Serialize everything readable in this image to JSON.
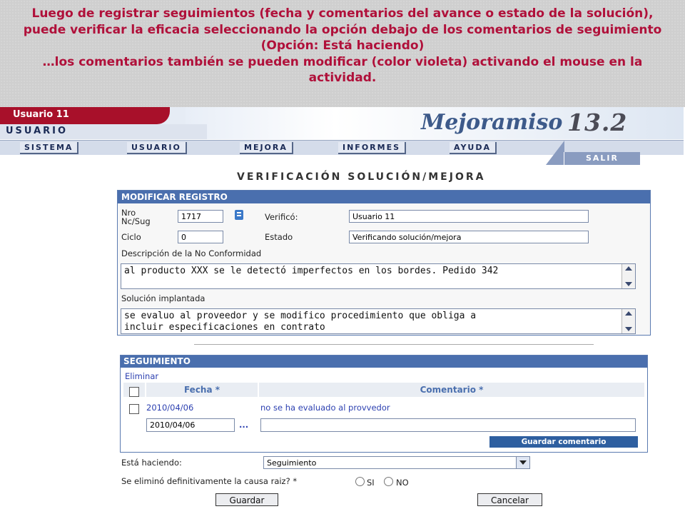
{
  "caption": {
    "line1": "Luego de registrar seguimientos (fecha y comentarios del avance o estado de la solución),",
    "line2": "puede verificar la eficacia seleccionando la opción debajo de los comentarios de seguimiento",
    "line3": "(Opción: Está haciendo)",
    "line4": "…los comentarios también se pueden modificar (color violeta) activando el mouse en la",
    "line5": "actividad."
  },
  "header": {
    "user_name": "Usuario 11",
    "user_label": "USUARIO",
    "logo_text": "Mejoramiso",
    "logo_version": "13.2"
  },
  "menu": {
    "items": [
      "SISTEMA",
      "USUARIO",
      "MEJORA",
      "INFORMES",
      "AYUDA"
    ],
    "exit": "SALIR"
  },
  "page_title": "VERIFICACIÓN SOLUCIÓN/MEJORA",
  "form": {
    "section_title": "MODIFICAR REGISTRO",
    "nro_label_1": "Nro",
    "nro_label_2": "Nc/Sug",
    "nro_value": "1717",
    "verifico_label": "Verificó:",
    "verifico_value": "Usuario 11",
    "ciclo_label": "Ciclo",
    "ciclo_value": "0",
    "estado_label": "Estado",
    "estado_value": "Verificando solución/mejora",
    "descripcion_label": "Descripción de la No Conformidad",
    "descripcion_value": "al producto XXX se le detectó imperfectos en los bordes. Pedido 342",
    "solucion_label": "Solución implantada",
    "solucion_line1": "se evaluo al proveedor y se modifico procedimiento que obliga a",
    "solucion_line2": "incluir especificaciones en contrato"
  },
  "seguimiento": {
    "title": "SEGUIMIENTO",
    "delete_link": "Eliminar",
    "col_fecha": "Fecha *",
    "col_comentario": "Comentario *",
    "rows": [
      {
        "fecha": "2010/04/06",
        "comentario": "no se ha evaluado al provvedor"
      }
    ],
    "new_fecha": "2010/04/06",
    "date_picker": "...",
    "new_comentario": "",
    "save_comment_button": "Guardar comentario"
  },
  "esta_haciendo": {
    "label": "Está haciendo:",
    "selected": "Seguimiento"
  },
  "causa": {
    "label": "Se eliminó definitivamente la causa raiz? *",
    "option_si": "SI",
    "option_no": "NO"
  },
  "buttons": {
    "save": "Guardar",
    "cancel": "Cancelar"
  },
  "colors": {
    "caption_text": "#b0103a",
    "header_red": "#a8102a",
    "panel_header": "#4a6fae",
    "link": "#2b3fb0"
  }
}
